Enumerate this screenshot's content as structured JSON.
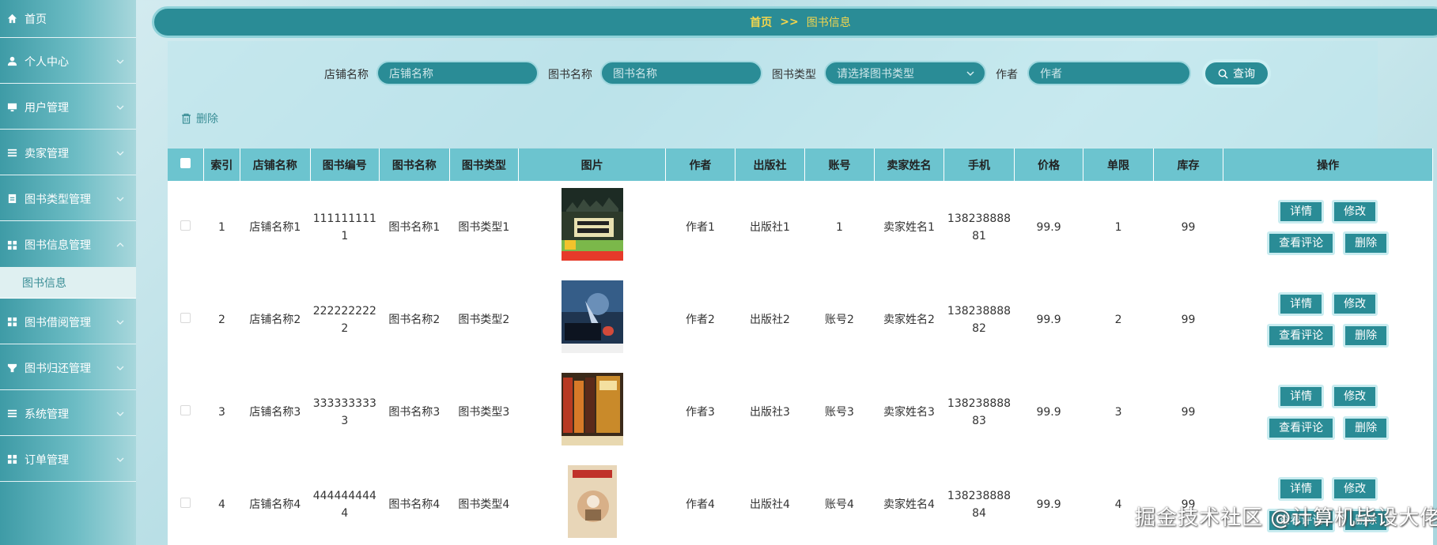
{
  "sidebar": {
    "items": [
      {
        "label": "首页",
        "icon": "home-icon"
      },
      {
        "label": "个人中心",
        "icon": "user-icon"
      },
      {
        "label": "用户管理",
        "icon": "monitor-icon"
      },
      {
        "label": "卖家管理",
        "icon": "list-icon"
      },
      {
        "label": "图书类型管理",
        "icon": "clipboard-icon"
      },
      {
        "label": "图书信息管理",
        "icon": "grid-icon"
      },
      {
        "label": "图书借阅管理",
        "icon": "grid-icon"
      },
      {
        "label": "图书归还管理",
        "icon": "filter-icon"
      },
      {
        "label": "系统管理",
        "icon": "list-icon"
      },
      {
        "label": "订单管理",
        "icon": "grid-icon"
      }
    ],
    "active_sub": "图书信息"
  },
  "breadcrumb": {
    "home": "首页",
    "separator": ">>",
    "current": "图书信息"
  },
  "search": {
    "shop_label": "店铺名称",
    "shop_placeholder": "店铺名称",
    "book_label": "图书名称",
    "book_placeholder": "图书名称",
    "type_label": "图书类型",
    "type_placeholder": "请选择图书类型",
    "author_label": "作者",
    "author_placeholder": "作者",
    "button": "查询"
  },
  "actions": {
    "delete": "删除"
  },
  "table": {
    "headers": [
      "索引",
      "店铺名称",
      "图书编号",
      "图书名称",
      "图书类型",
      "图片",
      "作者",
      "出版社",
      "账号",
      "卖家姓名",
      "手机",
      "价格",
      "单限",
      "库存",
      "操作"
    ],
    "rows": [
      {
        "index": "1",
        "shop": "店铺名称1",
        "code": "1111111111",
        "name": "图书名称1",
        "type": "图书类型1",
        "author": "作者1",
        "publisher": "出版社1",
        "account": "1",
        "seller": "卖家姓名1",
        "phone": "13823888881",
        "price": "99.9",
        "limit": "1",
        "stock": "99"
      },
      {
        "index": "2",
        "shop": "店铺名称2",
        "code": "2222222222",
        "name": "图书名称2",
        "type": "图书类型2",
        "author": "作者2",
        "publisher": "出版社2",
        "account": "账号2",
        "seller": "卖家姓名2",
        "phone": "13823888882",
        "price": "99.9",
        "limit": "2",
        "stock": "99"
      },
      {
        "index": "3",
        "shop": "店铺名称3",
        "code": "3333333333",
        "name": "图书名称3",
        "type": "图书类型3",
        "author": "作者3",
        "publisher": "出版社3",
        "account": "账号3",
        "seller": "卖家姓名3",
        "phone": "13823888883",
        "price": "99.9",
        "limit": "3",
        "stock": "99"
      },
      {
        "index": "4",
        "shop": "店铺名称4",
        "code": "4444444444",
        "name": "图书名称4",
        "type": "图书类型4",
        "author": "作者4",
        "publisher": "出版社4",
        "account": "账号4",
        "seller": "卖家姓名4",
        "phone": "13823888884",
        "price": "99.9",
        "limit": "4",
        "stock": "99"
      }
    ],
    "op_buttons": {
      "detail": "详情",
      "edit": "修改",
      "comments": "查看评论",
      "delete": "删除"
    }
  },
  "watermark": "掘金技术社区 @计算机毕设大佬",
  "colors": {
    "primary": "#2a8c96",
    "header": "#6cc4cf",
    "accent": "#f4d64d"
  }
}
